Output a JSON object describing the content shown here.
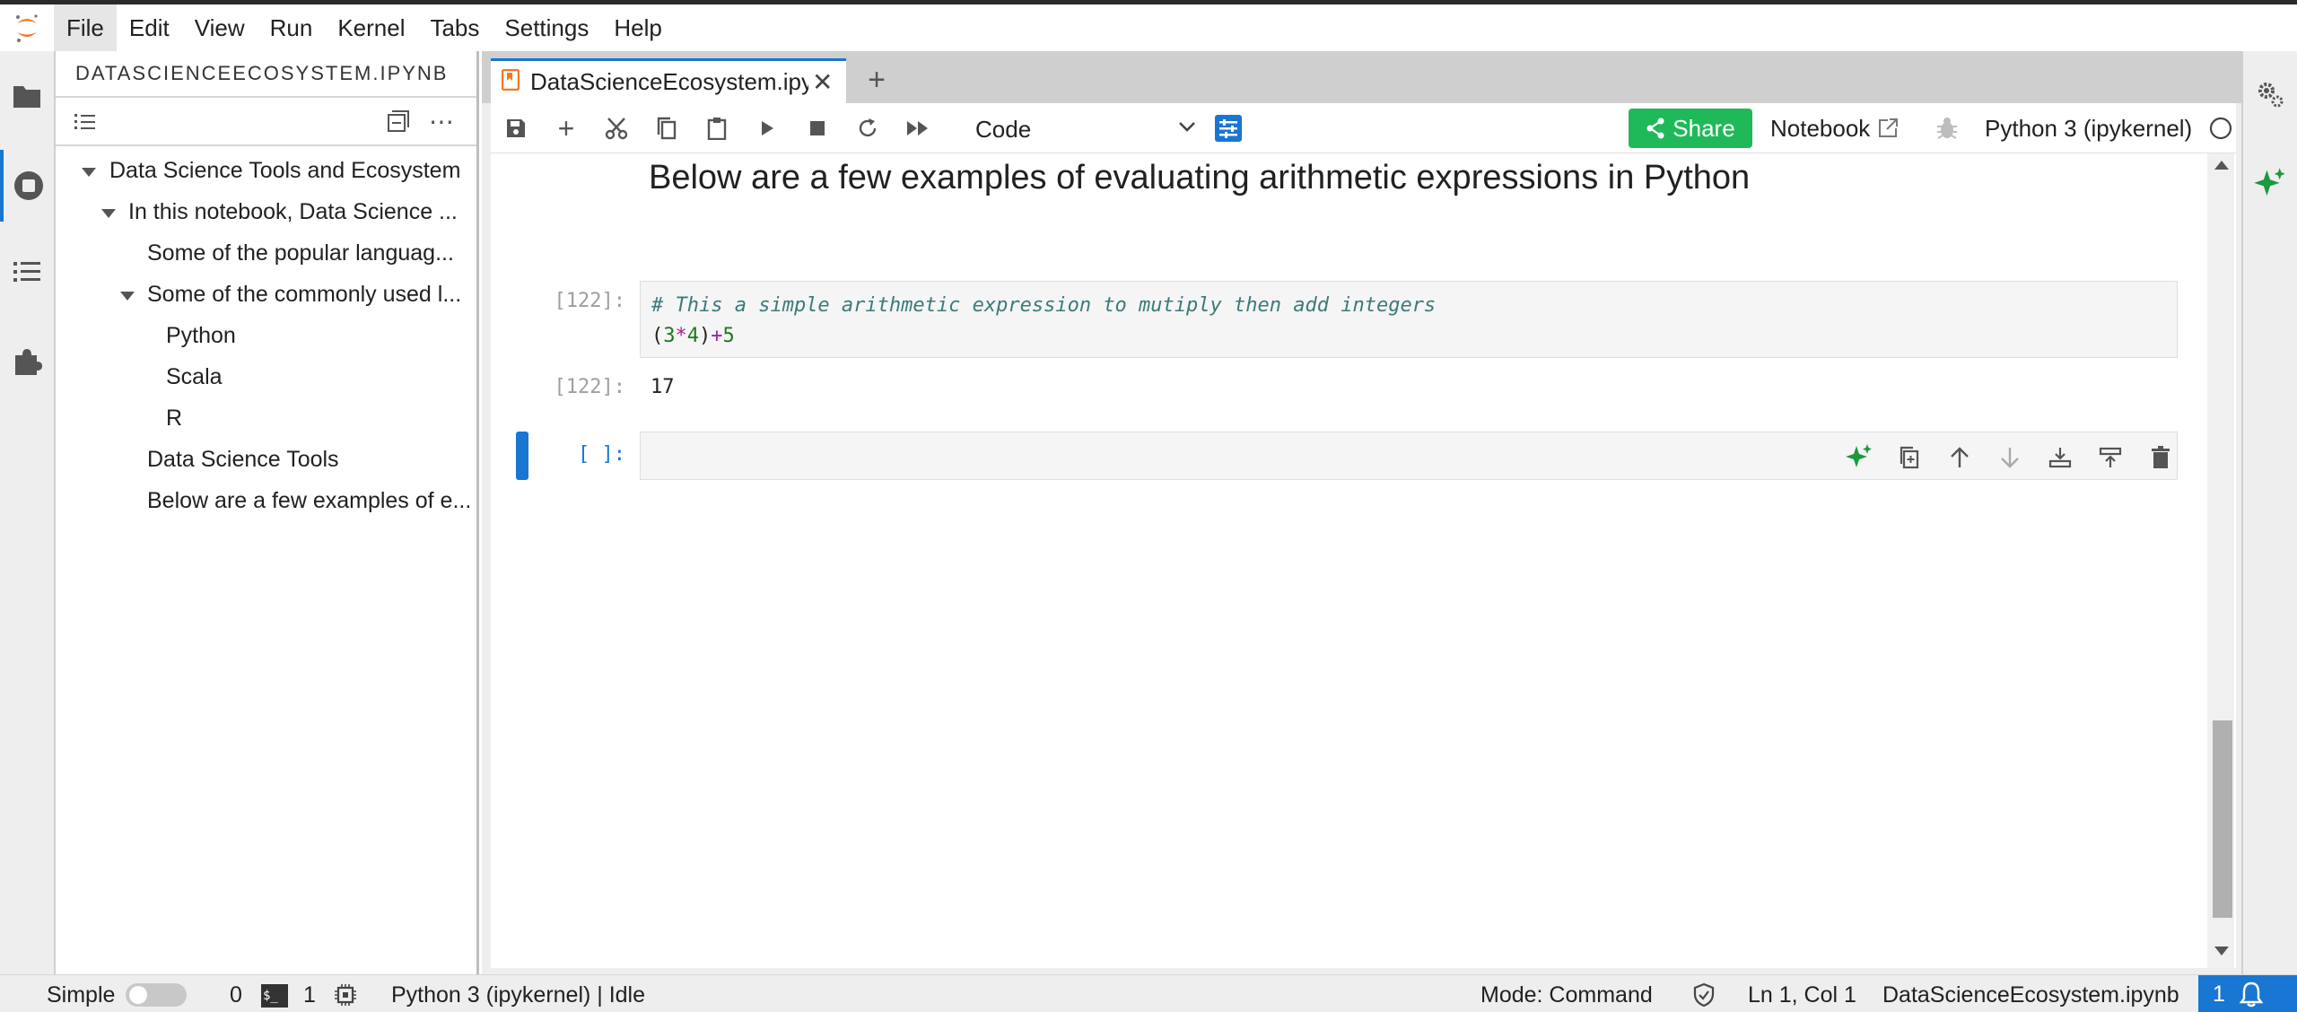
{
  "menu": [
    "File",
    "Edit",
    "View",
    "Run",
    "Kernel",
    "Tabs",
    "Settings",
    "Help"
  ],
  "left_panel": {
    "title": "DATASCIENCEECOSYSTEM.IPYNB",
    "toc": [
      "Data Science Tools and Ecosystem",
      "In this notebook, Data Science ...",
      "Some of the popular languag...",
      "Some of the commonly used l...",
      "Python",
      "Scala",
      "R",
      "Data Science Tools",
      "Below are a few examples of e..."
    ]
  },
  "tab": {
    "label": "DataScienceEcosystem.ipynb"
  },
  "toolbar": {
    "cell_type": "Code",
    "share_label": "Share",
    "notebook_label": "Notebook",
    "kernel_label": "Python 3 (ipykernel)"
  },
  "notebook": {
    "heading": "Below are a few examples of evaluating arithmetic expressions in Python",
    "cell1_prompt": "[122]:",
    "cell1_comment": "# This a simple arithmetic expression to mutiply then add integers",
    "cell1_code": "(3*4)+5",
    "out1_prompt": "[122]:",
    "out1_value": "17",
    "cell2_prompt": "[ ]:"
  },
  "status": {
    "mode_label": "Simple",
    "kernels_count": "0",
    "terminals_count": "1",
    "kernel_status": "Python 3 (ipykernel) | Idle",
    "mode": "Mode: Command",
    "position": "Ln 1, Col 1",
    "filename": "DataScienceEcosystem.ipynb",
    "notifications": "1"
  },
  "colors": {
    "accent": "#1976d2",
    "share": "#1fb95a",
    "jupyter_orange": "#f37726",
    "ai_green": "#1a9a3c"
  }
}
